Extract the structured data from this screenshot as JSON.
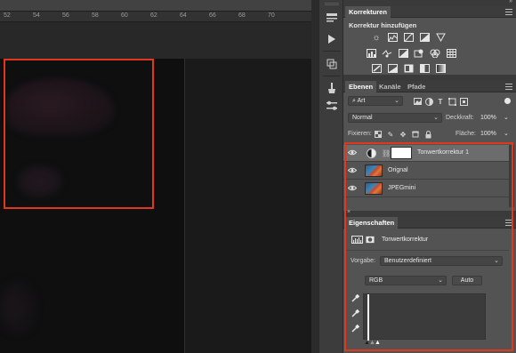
{
  "ruler": {
    "labels": [
      "52",
      "54",
      "56",
      "58",
      "60",
      "62",
      "64",
      "66",
      "68",
      "70"
    ]
  },
  "icon_strip": {
    "icons": [
      "collapse-arrows-icon",
      "properties-icon",
      "play-icon",
      "transform-icon",
      "brush-icon",
      "adjust-icon"
    ]
  },
  "adjustments": {
    "tab": "Korrekturen",
    "subtitle": "Korrektur hinzufügen",
    "row1_icons": [
      "brightness-icon",
      "levels-icon",
      "curves-icon",
      "exposure-icon",
      "vibrance-icon"
    ],
    "row2_icons": [
      "hue-saturation-icon",
      "color-balance-icon",
      "black-white-icon",
      "photo-filter-icon",
      "channel-mixer-icon",
      "color-lookup-icon"
    ],
    "row3_icons": [
      "invert-icon",
      "posterize-icon",
      "threshold-icon",
      "selective-color-icon",
      "gradient-map-icon"
    ]
  },
  "layers_panel": {
    "tabs": [
      "Ebenen",
      "Kanäle",
      "Pfade"
    ],
    "filter_value": "Art",
    "filter_icons": [
      "image-filter-icon",
      "adjust-filter-icon",
      "text-filter-icon",
      "shape-filter-icon",
      "smart-filter-icon"
    ],
    "blend_mode": "Normal",
    "opacity_label": "Deckkraft:",
    "opacity_value": "100%",
    "lock_label": "Fixieren:",
    "fill_label": "Fläche:",
    "fill_value": "100%",
    "layers": [
      {
        "name": "Tonwertkorrektur 1",
        "kind": "adjustment",
        "selected": true
      },
      {
        "name": "Orignal",
        "kind": "photo",
        "selected": false
      },
      {
        "name": "JPEGmini",
        "kind": "photo",
        "selected": false
      }
    ]
  },
  "properties_panel": {
    "tab": "Eigenschaften",
    "title": "Tonwertkorrektur",
    "preset_label": "Vorgabe:",
    "preset_value": "Benutzerdefiniert",
    "channel_value": "RGB",
    "auto_label": "Auto"
  },
  "colors": {
    "accent_red": "#e0371f",
    "panel_bg": "#535353",
    "selected_layer": "#6c6c6c"
  }
}
